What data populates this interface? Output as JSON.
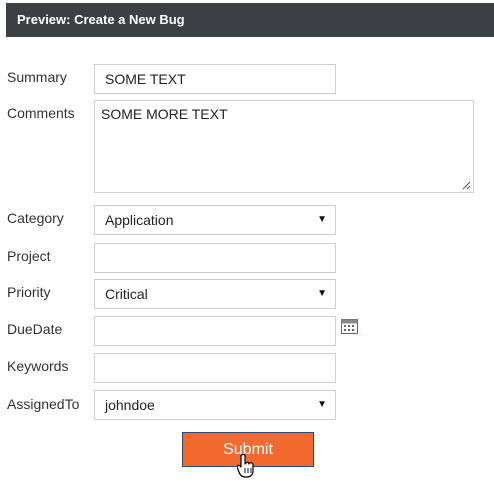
{
  "header": {
    "title": "Preview: Create a New Bug"
  },
  "form": {
    "summary": {
      "label": "Summary",
      "value": "SOME TEXT"
    },
    "comments": {
      "label": "Comments",
      "value": "SOME MORE TEXT"
    },
    "category": {
      "label": "Category",
      "value": "Application"
    },
    "project": {
      "label": "Project",
      "value": ""
    },
    "priority": {
      "label": "Priority",
      "value": "Critical"
    },
    "duedate": {
      "label": "DueDate",
      "value": ""
    },
    "keywords": {
      "label": "Keywords",
      "value": ""
    },
    "assignedto": {
      "label": "AssignedTo",
      "value": "johndoe"
    }
  },
  "submit": {
    "label": "Submit"
  },
  "icons": {
    "dropdown": "chevron-down-icon",
    "calendar": "calendar-icon",
    "cursor": "hand-pointer-icon"
  },
  "colors": {
    "header_bg": "#3c3f44",
    "submit_bg": "#f26a2e",
    "submit_border": "#2c4a78"
  }
}
